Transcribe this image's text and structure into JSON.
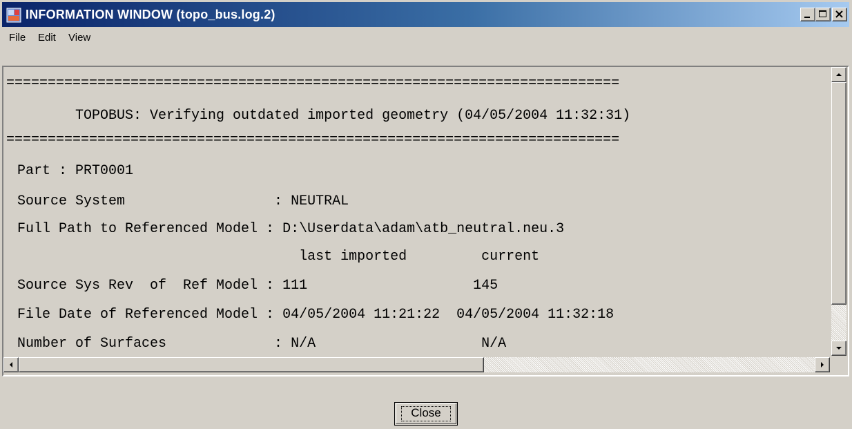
{
  "window": {
    "title": "INFORMATION WINDOW (topo_bus.log.2)"
  },
  "menu": [
    "File",
    "Edit",
    "View"
  ],
  "log": {
    "separator": "==========================================================================",
    "heading": "       TOPOBUS: Verifying outdated imported geometry (04/05/2004 11:32:31)",
    "part": "Part : PRT0001",
    "source_system": "Source System                  : NEUTRAL",
    "full_path": "Full Path to Referenced Model : D:\\Userdata\\adam\\atb_neutral.neu.3",
    "column_headers": "                                  last imported         current",
    "source_rev": "Source Sys Rev  of  Ref Model : 111                    145",
    "file_date": "File Date of Referenced Model : 04/05/2004 11:21:22  04/05/2004 11:32:18",
    "surfaces": "Number of Surfaces             : N/A                    N/A"
  },
  "close_button": "Close",
  "colors": {
    "title_start": "#0a246a",
    "title_end": "#a6caf0",
    "face": "#d4d0c8"
  }
}
